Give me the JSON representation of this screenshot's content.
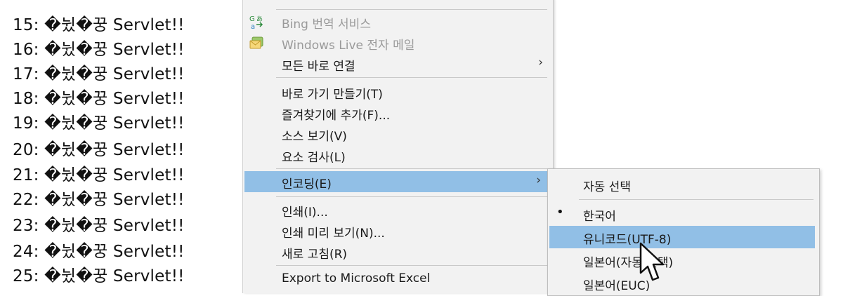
{
  "page": {
    "lines": [
      "15: �뉬�꿍 Servlet!!",
      "16: �뉬�꿍 Servlet!!",
      "17: �뉬�꿍 Servlet!!",
      "18: �뉬�꿍 Servlet!!",
      "19: �뉬�꿍 Servlet!!",
      "20: �뉬�꿍 Servlet!!",
      "21: �뉬�꿍 Servlet!!",
      "22: �뉬�꿍 Servlet!!",
      "23: �뉬�꿍 Servlet!!",
      "24: �뉬�꿍 Servlet!!",
      "25: �뉬�꿍 Servlet!!"
    ]
  },
  "context_menu": {
    "bing_translate": "Bing 번역 서비스",
    "live_mail": "Windows Live 전자 메일",
    "all_shortcuts": "모든 바로 연결",
    "create_shortcut": "바로 가기 만들기(T)",
    "add_favorites": "즐겨찾기에 추가(F)...",
    "view_source": "소스 보기(V)",
    "inspect": "요소 검사(L)",
    "encoding": "인코딩(E)",
    "print": "인쇄(I)...",
    "print_preview": "인쇄 미리 보기(N)...",
    "refresh": "새로 고침(R)",
    "export_excel": "Export to Microsoft Excel",
    "submenu_arrow": "›"
  },
  "encoding_menu": {
    "auto_select": "자동 선택",
    "korean": "한국어",
    "unicode": "유니코드(UTF-8)",
    "japanese_auto": "일본어(자동 선택)",
    "japanese_euc": "일본어(EUC)",
    "check_mark": "•"
  },
  "colors": {
    "highlight": "#91bfe6",
    "menu_bg": "#f2f2f2",
    "disabled_text": "#9a9a9a"
  },
  "icons": {
    "translate": "translate-icon",
    "mail": "mail-icon",
    "cursor": "mouse-pointer-icon"
  }
}
